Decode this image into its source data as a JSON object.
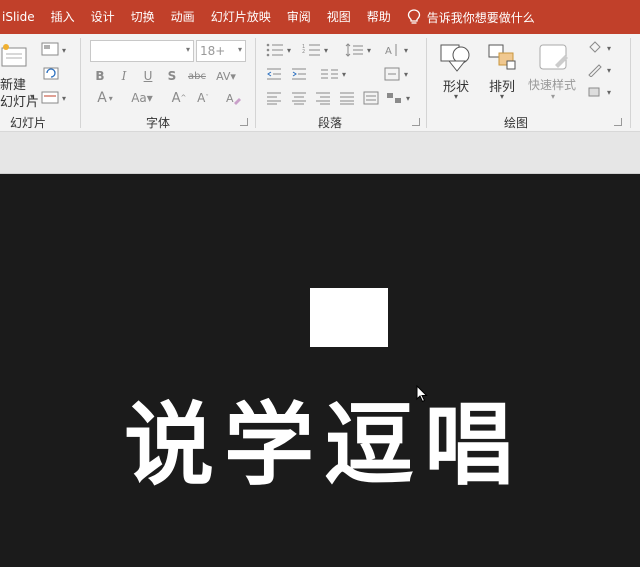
{
  "menubar": {
    "tabs": [
      "iSlide",
      "插入",
      "设计",
      "切换",
      "动画",
      "幻灯片放映",
      "审阅",
      "视图",
      "帮助"
    ],
    "tell_me": "告诉我你想要做什么",
    "bg_color": "#c1402a"
  },
  "ribbon": {
    "slides_group": {
      "new_slide_label_1": "新建",
      "new_slide_label_2": "幻灯片",
      "group_label": "幻灯片"
    },
    "font_group": {
      "font_name_value": "",
      "font_size_value": "18+",
      "group_label": "字体"
    },
    "paragraph_group": {
      "group_label": "段落"
    },
    "drawing_group": {
      "shape_label": "形状",
      "arrange_label": "排列",
      "quick_styles_label": "快速样式",
      "group_label": "绘图"
    }
  },
  "slide": {
    "title": "说学逗唱",
    "bg_color": "#1b1b1b"
  }
}
